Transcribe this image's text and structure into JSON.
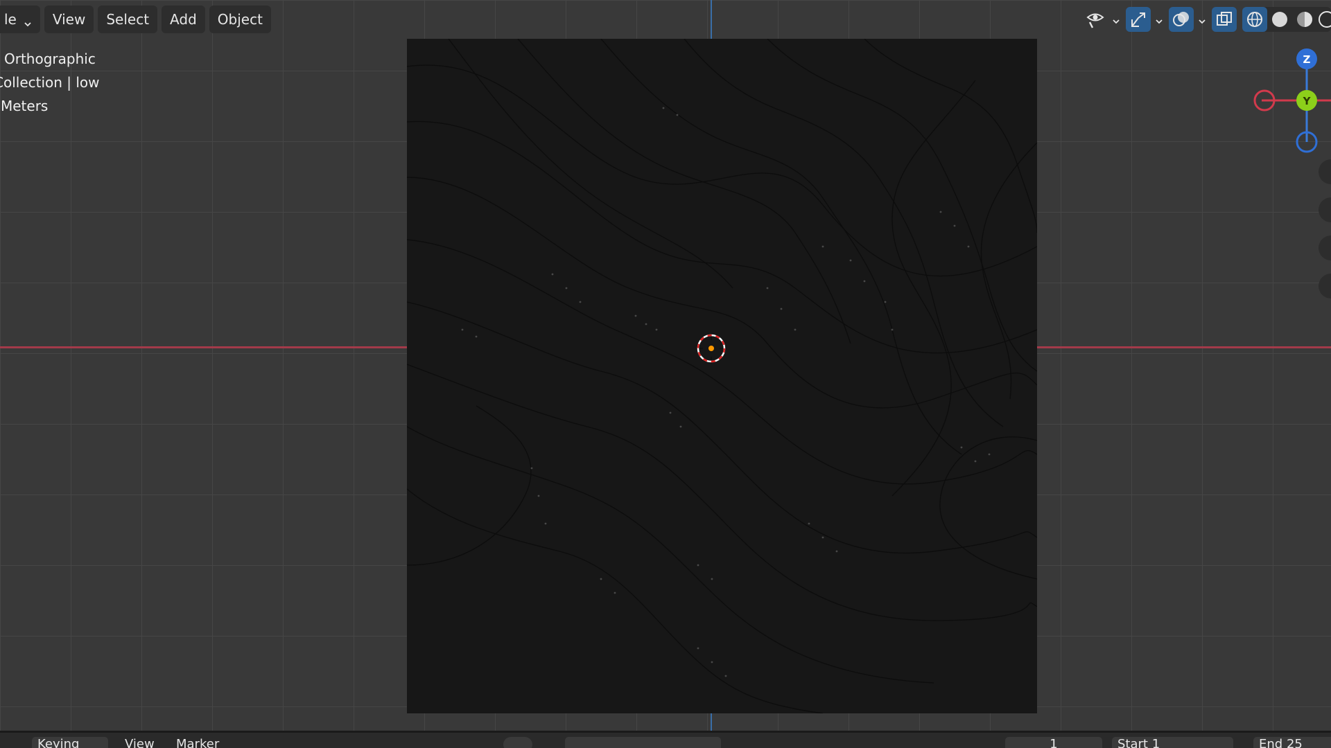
{
  "header": {
    "mode_partial": "le",
    "menu": [
      "View",
      "Select",
      "Add",
      "Object"
    ]
  },
  "overlay": {
    "view_name": "Orthographic",
    "collection": "Collection | low",
    "units": "Meters"
  },
  "gizmo": {
    "z_label": "Z",
    "y_label": "Y"
  },
  "timeline": {
    "dope_label": "Keying",
    "view_label": "View",
    "marker_label": "Marker",
    "current_frame": "1",
    "start_label": "Start",
    "start_value": "1",
    "end_label": "End",
    "end_value": "25"
  },
  "colors": {
    "x_axis": "#a33a4a",
    "y_axis": "#3a6ea8",
    "gizmo_z": "#2f6fd6",
    "gizmo_y": "#8ccf1a",
    "gizmo_x": "#d23a4c",
    "plane": "#171717",
    "viewport_bg": "#393939"
  },
  "icons": [
    "chevron-down-icon",
    "visibility-eye-icon",
    "gizmo-toggle-icon",
    "overlay-icon",
    "xray-icon",
    "wireframe-shading-icon",
    "solid-shading-icon",
    "material-shading-icon",
    "rendered-shading-icon"
  ]
}
